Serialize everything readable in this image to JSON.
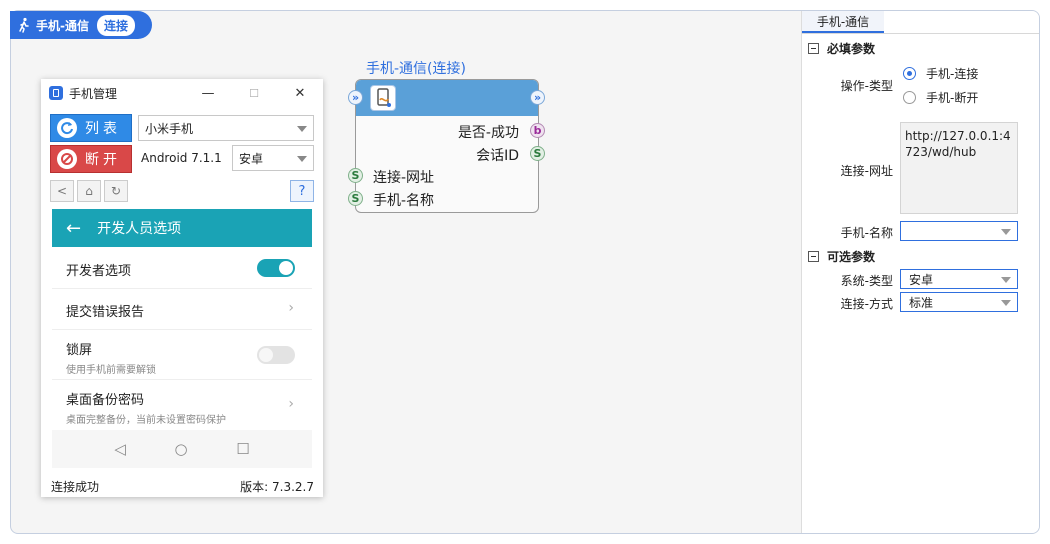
{
  "breadcrumb": {
    "name": "手机-通信",
    "badge": "连接",
    "icon": "walk-icon"
  },
  "phone_window": {
    "title": "手机管理",
    "minimize": "—",
    "maximize": "☐",
    "close": "✕",
    "list_button": "列表",
    "disconnect_button": "断开",
    "device_select": "小米手机",
    "android_version": "Android 7.1.1",
    "os_select": "安卓",
    "nav": {
      "back": "<",
      "home": "⌂",
      "refresh": "↻",
      "help": "?"
    },
    "screen": {
      "header": "开发人员选项",
      "back_arrow": "←",
      "rows": [
        {
          "title": "开发者选项",
          "subtitle": ""
        },
        {
          "title": "提交错误报告",
          "subtitle": ""
        },
        {
          "title": "锁屏",
          "subtitle": "使用手机前需要解锁"
        },
        {
          "title": "桌面备份密码",
          "subtitle": "桌面完整备份，当前未设置密码保护"
        }
      ],
      "chevron": "›",
      "sysnav": {
        "back": "◁",
        "home": "○",
        "recent": "☐"
      }
    },
    "status": "连接成功",
    "version": "版本: 7.3.2.7"
  },
  "node": {
    "title": "手机-通信(连接)",
    "outputs": [
      {
        "label": "是否-成功",
        "port": "b"
      },
      {
        "label": "会话ID",
        "port": "S"
      }
    ],
    "inputs": [
      {
        "label": "连接-网址",
        "port": "S"
      },
      {
        "label": "手机-名称",
        "port": "S"
      }
    ],
    "flow_port": "»"
  },
  "panel": {
    "tab": "手机-通信",
    "required_section": "必填参数",
    "op_type_label": "操作-类型",
    "op_options": [
      "手机-连接",
      "手机-断开"
    ],
    "url_label": "连接-网址",
    "url_value": "http://127.0.0.1:4723/wd/hub",
    "phone_name_label": "手机-名称",
    "phone_name_value": "",
    "optional_section": "可选参数",
    "sys_type_label": "系统-类型",
    "sys_type_value": "安卓",
    "conn_mode_label": "连接-方式",
    "conn_mode_value": "标准"
  },
  "colors": {
    "accent": "#2f6fde",
    "danger": "#d94848",
    "teal": "#1aa3b5",
    "node_header": "#5aa0d8"
  }
}
